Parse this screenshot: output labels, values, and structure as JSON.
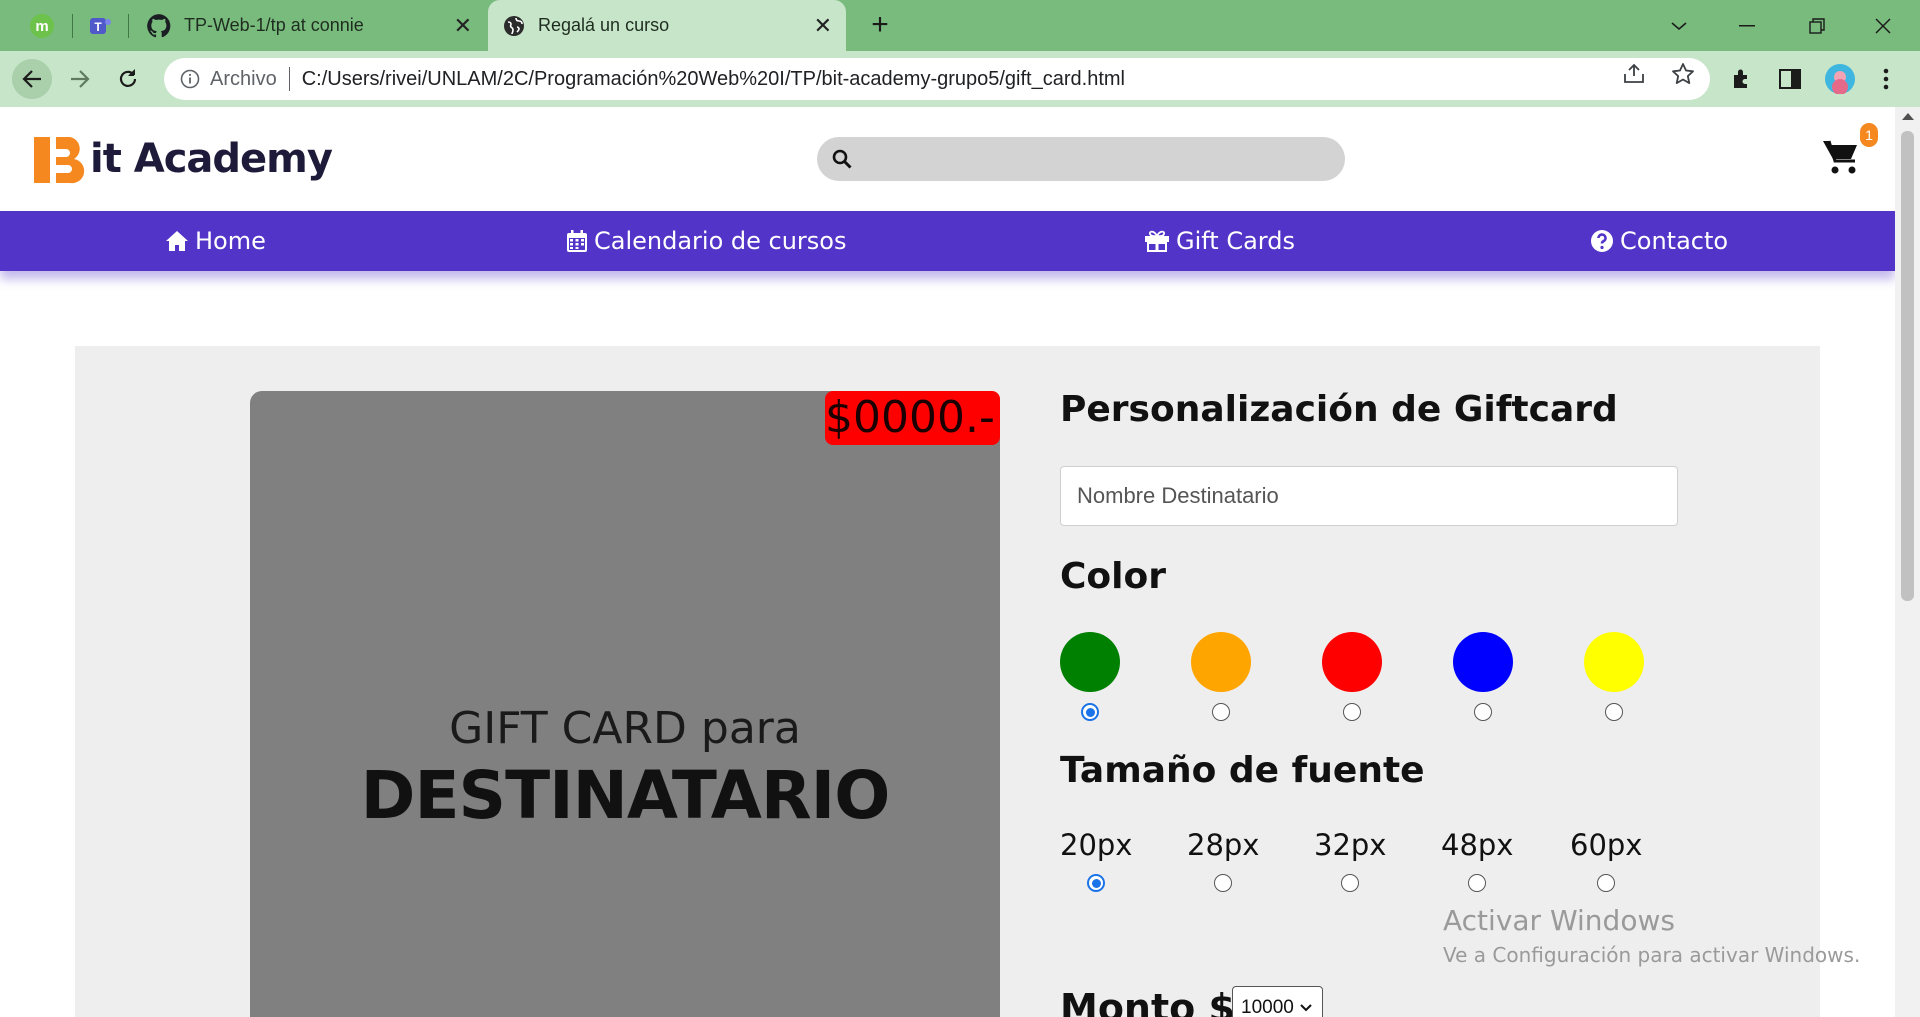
{
  "browser": {
    "tabs": [
      {
        "title": "TP-Web-1/tp at connie",
        "active": false
      },
      {
        "title": "Regalá un curso",
        "active": true
      }
    ],
    "address": {
      "security_label": "Archivo",
      "url": "C:/Users/rivei/UNLAM/2C/Programación%20Web%20I/TP/bit-academy-grupo5/gift_card.html"
    },
    "colors": {
      "tabstrip": "#79bb7d",
      "toolbar": "#c7e5c8"
    }
  },
  "site": {
    "logo_text": "it Academy",
    "search_placeholder": "",
    "cart_count": "1",
    "nav": [
      {
        "label": "Home",
        "icon": "home-icon"
      },
      {
        "label": "Calendario de cursos",
        "icon": "calendar-icon"
      },
      {
        "label": "Gift Cards",
        "icon": "gift-icon"
      },
      {
        "label": "Contacto",
        "icon": "question-circle-icon"
      }
    ],
    "colors": {
      "nav_bg": "#5334c8",
      "logo_orange": "#f5881f",
      "logo_text": "#1e1b3a"
    }
  },
  "preview": {
    "price": "$0000.-",
    "line1": "GIFT CARD para",
    "line2": "DESTINATARIO",
    "colors": {
      "card_bg": "#808080",
      "price_bg": "#ff0000"
    }
  },
  "form": {
    "title": "Personalización de Giftcard",
    "name_placeholder": "Nombre Destinatario",
    "color_heading": "Color",
    "color_options": [
      {
        "color": "#008000",
        "checked": true
      },
      {
        "color": "#ffa500",
        "checked": false
      },
      {
        "color": "#ff0000",
        "checked": false
      },
      {
        "color": "#0000ff",
        "checked": false
      },
      {
        "color": "#ffff00",
        "checked": false
      }
    ],
    "size_heading": "Tamaño de fuente",
    "size_options": [
      {
        "label": "20px",
        "checked": true
      },
      {
        "label": "28px",
        "checked": false
      },
      {
        "label": "32px",
        "checked": false
      },
      {
        "label": "48px",
        "checked": false
      },
      {
        "label": "60px",
        "checked": false
      }
    ],
    "amount_label": "Monto $",
    "amount_value": "10000"
  },
  "watermark": {
    "line1": "Activar Windows",
    "line2": "Ve a Configuración para activar Windows."
  }
}
